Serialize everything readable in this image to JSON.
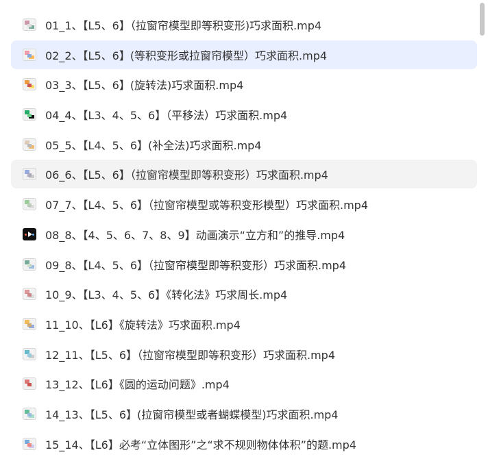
{
  "files": [
    {
      "name": "01_1、【L5、6】（拉窗帘模型即等积变形)巧求面积.mp4",
      "thumb": "video-thumbnail-icon",
      "state": "normal",
      "colors": [
        "#c9a",
        "#7a9",
        "#ddd"
      ]
    },
    {
      "name": "02_2、【L5、6】(等积变形或拉窗帘模型）巧求面积.mp4",
      "thumb": "video-thumbnail-icon",
      "state": "selected",
      "colors": [
        "#e9a",
        "#fb5",
        "#8ad"
      ]
    },
    {
      "name": "03_3、【L5、6】(旋转法)巧求面积.mp4",
      "thumb": "video-thumbnail-icon",
      "state": "normal",
      "colors": [
        "#e94",
        "#fd6",
        "#c55"
      ]
    },
    {
      "name": "04_4、【L3、4、5、6】（平移法）巧求面积.mp4",
      "thumb": "video-thumbnail-icon",
      "state": "normal",
      "colors": [
        "#2a6",
        "#111",
        "#6c8"
      ]
    },
    {
      "name": "05_5、【L4、5、6】(补全法)巧求面积.mp4",
      "thumb": "video-thumbnail-icon",
      "state": "normal",
      "colors": [
        "#dcb",
        "#eb7",
        "#bbb"
      ]
    },
    {
      "name": "06_6、【L5、6】（拉窗帘模型即等积变形）巧求面积.mp4",
      "thumb": "video-thumbnail-icon",
      "state": "hover",
      "colors": [
        "#9ad",
        "#ccc",
        "#aab"
      ]
    },
    {
      "name": "07_7、【L4、5、6】（拉窗帘模型或等积变形模型）巧求面积.mp4",
      "thumb": "video-thumbnail-icon",
      "state": "normal",
      "colors": [
        "#9c9",
        "#ddd",
        "#bcb"
      ]
    },
    {
      "name": "08_8、【4、5、6、7、8、9】动画演示“立方和”的推导.mp4",
      "thumb": "video-thumbnail-dark-icon",
      "state": "normal",
      "colors": [
        "#111",
        "#111",
        "#111"
      ]
    },
    {
      "name": "09_8、【L4、5、6】（拉窗帘模型即等积变形）巧求面积.mp4",
      "thumb": "video-thumbnail-icon",
      "state": "normal",
      "colors": [
        "#7a9",
        "#9bd",
        "#cdc"
      ]
    },
    {
      "name": "10_9、【L3、4、5、6】《转化法》巧求周长.mp4",
      "thumb": "video-thumbnail-icon",
      "state": "normal",
      "colors": [
        "#d99",
        "#ddd",
        "#c88"
      ]
    },
    {
      "name": "11_10、【L6】《旋转法》巧求面积.mp4",
      "thumb": "video-thumbnail-icon",
      "state": "normal",
      "colors": [
        "#eb5",
        "#9ad",
        "#ca7"
      ]
    },
    {
      "name": "12_11、【L5、6】（拉窗帘模型即等积变形）巧求面积.mp4",
      "thumb": "video-thumbnail-icon",
      "state": "normal",
      "colors": [
        "#6bc",
        "#ccc",
        "#9cd"
      ]
    },
    {
      "name": "13_12、【L6】《圆的运动问题》.mp4",
      "thumb": "video-thumbnail-icon",
      "state": "normal",
      "colors": [
        "#d77",
        "#eee",
        "#c55"
      ]
    },
    {
      "name": "14_13、【L5、6】(拉窗帘模型或者蝴蝶模型)巧求面积.mp4",
      "thumb": "video-thumbnail-icon",
      "state": "normal",
      "colors": [
        "#6b9",
        "#adc",
        "#9bd"
      ]
    },
    {
      "name": "15_14、【L6】必考“立体图形”之“求不规则物体体积”的题.mp4",
      "thumb": "video-thumbnail-icon",
      "state": "normal",
      "colors": [
        "#7ad",
        "#cce",
        "#e88"
      ]
    }
  ]
}
